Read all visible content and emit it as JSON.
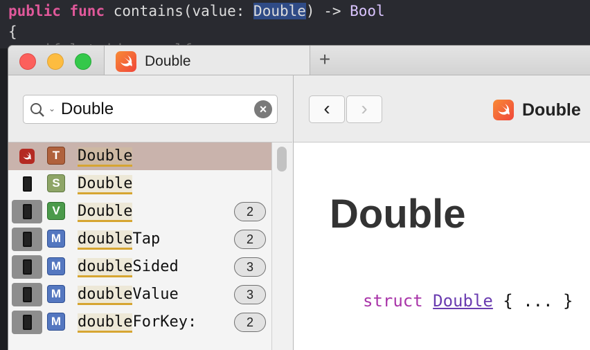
{
  "editor": {
    "line1_kw1": "public",
    "line1_kw2": "func",
    "line1_text1": "contains(value: ",
    "line1_selected": "Double",
    "line1_text2": ") -> ",
    "line1_type": "Bool",
    "line2": "{",
    "line3": "    if let idx = self"
  },
  "tabbar": {
    "tab_label": "Double",
    "new_tab": "+"
  },
  "search": {
    "value": "Double",
    "caret": "⌄",
    "clear": "×"
  },
  "results": [
    {
      "kind": "T",
      "prefix": "Double",
      "suffix": "",
      "count": "",
      "selected": true
    },
    {
      "kind": "S",
      "prefix": "Double",
      "suffix": "",
      "count": ""
    },
    {
      "kind": "V",
      "prefix": "Double",
      "suffix": "",
      "count": "2"
    },
    {
      "kind": "M",
      "prefix": "double",
      "suffix": "Tap",
      "count": "2"
    },
    {
      "kind": "M",
      "prefix": "double",
      "suffix": "Sided",
      "count": "3"
    },
    {
      "kind": "M",
      "prefix": "double",
      "suffix": "Value",
      "count": "3"
    },
    {
      "kind": "M",
      "prefix": "double",
      "suffix": "ForKey:",
      "count": "2"
    }
  ],
  "right": {
    "back": "‹",
    "forward": "›",
    "doc_header": "Double",
    "doc_title": "Double",
    "code_kw": "struct",
    "code_type": "Double",
    "code_rest": " { ... }"
  },
  "colors": {
    "accent_selection": "#c9b3ac",
    "highlight_underline": "#d6a531"
  }
}
